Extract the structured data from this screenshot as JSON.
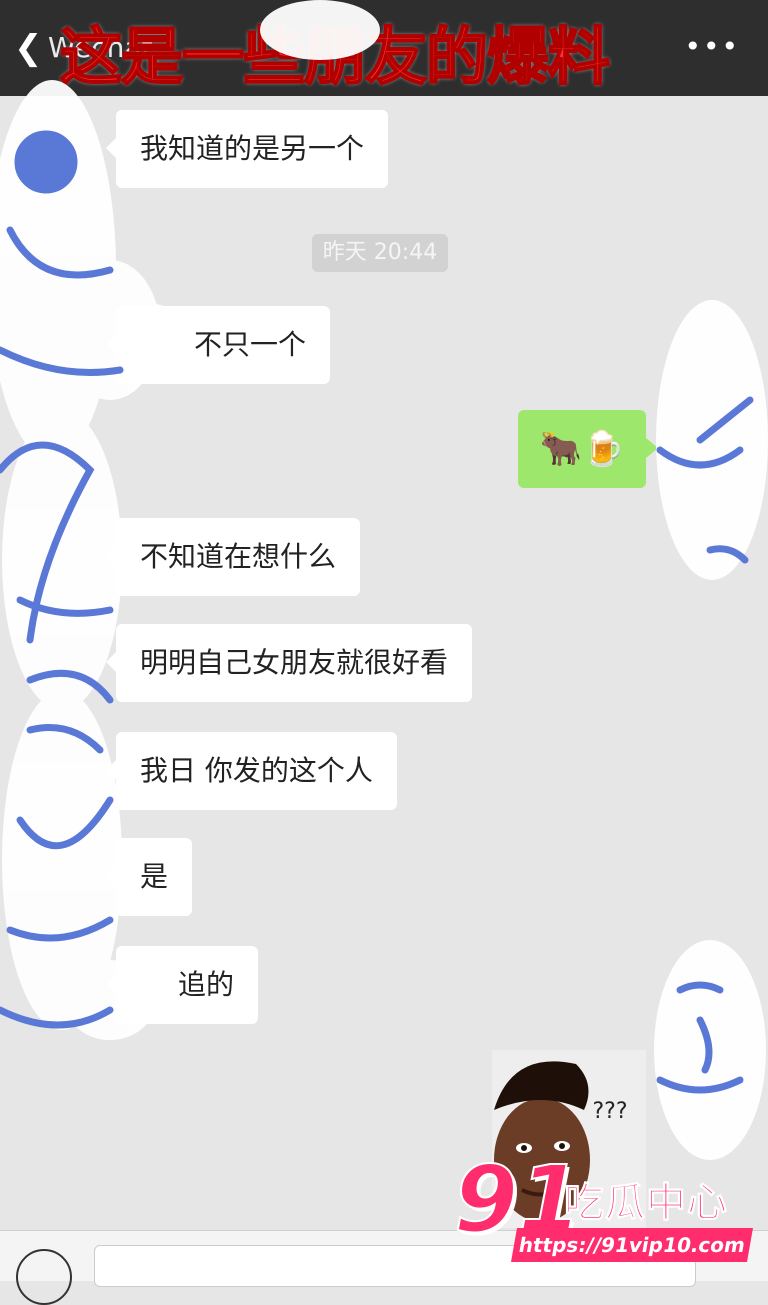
{
  "header": {
    "back_icon": "chevron-left-icon",
    "chat_name": "Wechat",
    "more_icon": "more-icon",
    "overlay_title": "这是一些朋友的爆料"
  },
  "messages": [
    {
      "side": "left",
      "text": "我知道的是另一个"
    },
    {
      "side": "left",
      "text": "不只一个"
    },
    {
      "side": "right",
      "text": "🐂🍺"
    },
    {
      "side": "left",
      "text": "不知道在想什么"
    },
    {
      "side": "left",
      "text": "明明自己女朋友就很好看"
    },
    {
      "side": "left",
      "text": "我日 你发的这个人"
    },
    {
      "side": "left",
      "text": "是"
    },
    {
      "side": "left",
      "text": "追的"
    }
  ],
  "timestamp": "昨天 20:44",
  "sticker": {
    "text": "???"
  },
  "watermark": {
    "number": "91",
    "name": "吃瓜中心",
    "url": "https://91vip10.com"
  },
  "colors": {
    "header_bg": "#2e2e2e",
    "chat_bg": "#e6e6e6",
    "my_bubble": "#9de76c",
    "overlay_red": "#ff2d2d",
    "watermark_pink": "#ff2d6e",
    "scribble_blue": "#5a78d6"
  }
}
